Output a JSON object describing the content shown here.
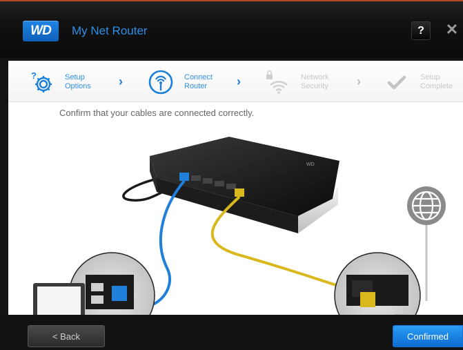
{
  "header": {
    "logo": "WD",
    "title": "My Net Router",
    "help_label": "?",
    "close_label": "✕"
  },
  "steps": [
    {
      "label": "Setup Options",
      "state": "active",
      "icon": "gear-question-icon"
    },
    {
      "label": "Connect Router",
      "state": "active",
      "icon": "wireless-antenna-icon"
    },
    {
      "label": "Network Security",
      "state": "inactive",
      "icon": "lock-wifi-icon"
    },
    {
      "label": "Setup Complete",
      "state": "inactive",
      "icon": "checkmark-icon"
    }
  ],
  "chevron": "›",
  "instruction": "Confirm that your cables are connected correctly.",
  "footer": {
    "back_label": "< Back",
    "confirm_label": "Confirmed"
  },
  "colors": {
    "accent_blue": "#2e8fe8",
    "cable_blue": "#1f7fd9",
    "cable_yellow": "#d8b81c"
  }
}
